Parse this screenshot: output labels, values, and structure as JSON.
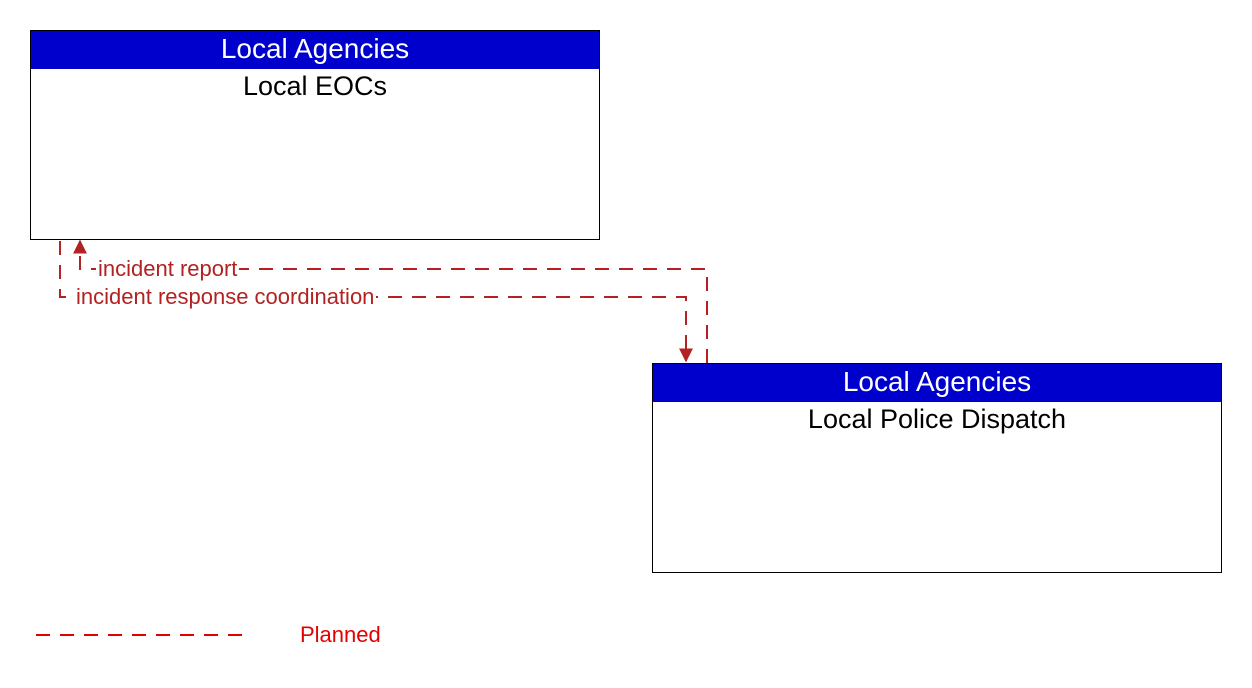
{
  "boxes": {
    "top": {
      "header": "Local Agencies",
      "body": "Local EOCs"
    },
    "bottom": {
      "header": "Local Agencies",
      "body": "Local Police Dispatch"
    }
  },
  "flows": {
    "toTop": "incident report",
    "toBottom": "incident response coordination"
  },
  "legend": {
    "planned": "Planned"
  },
  "colors": {
    "header_bg": "#0000cc",
    "flow": "#b22222",
    "legend": "#e20000"
  }
}
